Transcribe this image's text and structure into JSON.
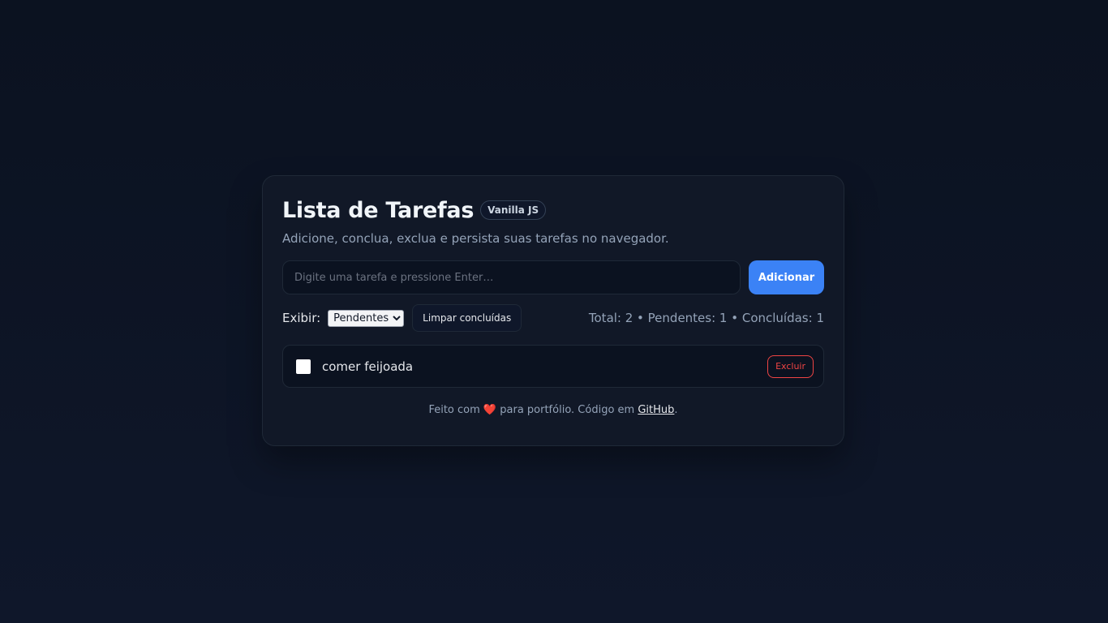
{
  "header": {
    "title": "Lista de Tarefas",
    "badge": "Vanilla JS",
    "subtitle": "Adicione, conclua, exclua e persista suas tarefas no navegador."
  },
  "add_form": {
    "placeholder": "Digite uma tarefa e pressione Enter…",
    "value": "",
    "button_label": "Adicionar"
  },
  "controls": {
    "filter_label": "Exibir:",
    "filter_selected": "Pendentes",
    "clear_label": "Limpar concluídas",
    "stats": "Total: 2 • Pendentes: 1 • Concluídas: 1"
  },
  "tasks": [
    {
      "text": "comer feijoada",
      "done": false,
      "delete_label": "Excluir"
    }
  ],
  "footer": {
    "prefix": "Feito com",
    "heart": "❤️",
    "middle": "para portfólio. Código em",
    "link_text": "GitHub",
    "suffix": "."
  },
  "colors": {
    "background": "#0f172a",
    "card": "#111827",
    "accent": "#3b82f6",
    "danger": "#ef4444"
  }
}
